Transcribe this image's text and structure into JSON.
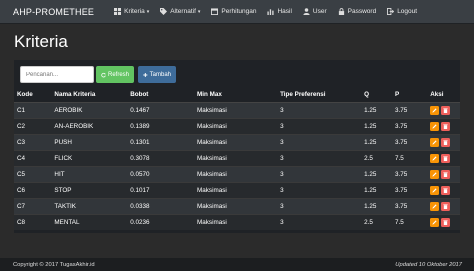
{
  "navbar": {
    "brand": "AHP-PROMETHEE",
    "items": [
      {
        "label": "Kriteria",
        "icon": "grid-icon",
        "dropdown": true
      },
      {
        "label": "Alternatif",
        "icon": "tag-icon",
        "dropdown": true
      },
      {
        "label": "Perhitungan",
        "icon": "calendar-icon",
        "dropdown": false
      },
      {
        "label": "Hasil",
        "icon": "chart-icon",
        "dropdown": false
      },
      {
        "label": "User",
        "icon": "user-icon",
        "dropdown": false
      },
      {
        "label": "Password",
        "icon": "lock-icon",
        "dropdown": false
      },
      {
        "label": "Logout",
        "icon": "logout-icon",
        "dropdown": false
      }
    ]
  },
  "page": {
    "title": "Kriteria"
  },
  "toolbar": {
    "search_placeholder": "Pencarian...",
    "refresh_label": "Refresh",
    "tambah_label": "Tambah"
  },
  "table": {
    "columns": [
      "Kode",
      "Nama Kriteria",
      "Bobot",
      "Min Max",
      "Tipe Preferensi",
      "Q",
      "P",
      "Aksi"
    ],
    "rows": [
      [
        "C1",
        "AEROBIK",
        "0.1467",
        "Maksimasi",
        "3",
        "1.25",
        "3.75"
      ],
      [
        "C2",
        "AN-AEROBIK",
        "0.1389",
        "Maksimasi",
        "3",
        "1.25",
        "3.75"
      ],
      [
        "C3",
        "PUSH",
        "0.1301",
        "Maksimasi",
        "3",
        "1.25",
        "3.75"
      ],
      [
        "C4",
        "FLICK",
        "0.3078",
        "Maksimasi",
        "3",
        "2.5",
        "7.5"
      ],
      [
        "C5",
        "HIT",
        "0.0570",
        "Maksimasi",
        "3",
        "1.25",
        "3.75"
      ],
      [
        "C6",
        "STOP",
        "0.1017",
        "Maksimasi",
        "3",
        "1.25",
        "3.75"
      ],
      [
        "C7",
        "TAKTIK",
        "0.0338",
        "Maksimasi",
        "3",
        "1.25",
        "3.75"
      ],
      [
        "C8",
        "MENTAL",
        "0.0236",
        "Maksimasi",
        "3",
        "2.5",
        "7.5"
      ]
    ]
  },
  "footer": {
    "copyright": "Copyright © 2017 TugasAkhir.id",
    "updated": "Updated 10 Oktober 2017"
  },
  "colors": {
    "navbar": "#3a3f44",
    "background": "#2b2b2b",
    "refresh": "#62c462",
    "tambah": "#3e6c9a",
    "edit": "#f89406",
    "delete": "#ee5f5b"
  }
}
